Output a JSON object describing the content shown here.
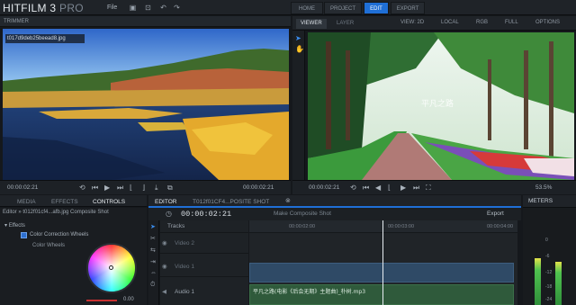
{
  "app": {
    "logo_name": "HITFILM 3",
    "logo_edition": "PRO",
    "file_menu": "File"
  },
  "main_tabs": [
    "HOME",
    "PROJECT",
    "EDIT",
    "EXPORT"
  ],
  "trimmer": {
    "title": "TRIMMER",
    "clip_name": "t017d9deb25beead8.jpg",
    "time_left": "00:00:02:21",
    "time_right": "00:00:02:21"
  },
  "viewer": {
    "tabs": [
      "VIEWER",
      "LAYER"
    ],
    "options": [
      "VIEW: 2D",
      "LOCAL",
      "RGB",
      "FULL",
      "OPTIONS"
    ],
    "time_left": "00:00:02:21",
    "zoom": "53.5%",
    "watermark": "平凡之路"
  },
  "controls": {
    "tabs": [
      "MEDIA",
      "EFFECTS",
      "CONTROLS"
    ],
    "path": "Editor » t012f01cf4...afb.jpg Composite Shot",
    "effects_label": "Effects",
    "effect_name": "Color Correction Wheels",
    "sub_label": "Color Wheels",
    "wheel_value": "0.00"
  },
  "editor": {
    "tabs": [
      "EDITOR",
      "T012f01CF4...POSITE SHOT"
    ],
    "timecode": "00:00:02:21",
    "make_composite": "Make Composite Shot",
    "export": "Export",
    "tracks_label": "Tracks",
    "track_names": [
      "Video 2",
      "Video 1",
      "Audio 1"
    ],
    "ruler": [
      "00:00:02:00",
      "00:00:03:00",
      "00:00:04:00"
    ],
    "audio_clip": "平凡之路(电影《后会无期》主题曲)_朴树.mp3"
  },
  "meters": {
    "title": "METERS",
    "scale": [
      "0",
      "-6",
      "-12",
      "-18",
      "-24"
    ]
  }
}
